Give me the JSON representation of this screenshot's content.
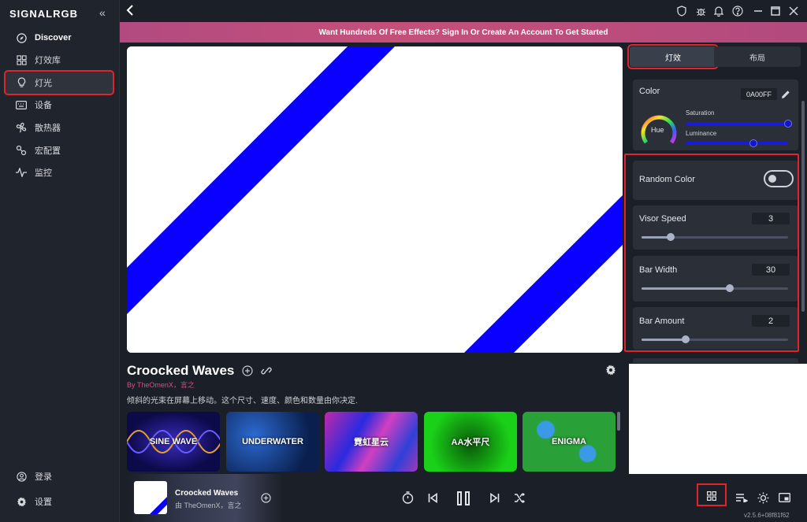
{
  "app": {
    "logo": "SIGNALRGB",
    "version": "v2.5.6+08f81f62"
  },
  "sidebar": {
    "items": [
      {
        "label": "Discover",
        "icon": "compass-icon"
      },
      {
        "label": "灯效库",
        "icon": "grid-icon"
      },
      {
        "label": "灯光",
        "icon": "bulb-icon",
        "active": true
      },
      {
        "label": "设备",
        "icon": "keyboard-icon"
      },
      {
        "label": "散热器",
        "icon": "fan-icon"
      },
      {
        "label": "宏配置",
        "icon": "macro-icon"
      },
      {
        "label": "监控",
        "icon": "pulse-icon"
      }
    ],
    "footer": [
      {
        "label": "登录",
        "icon": "user-icon"
      },
      {
        "label": "设置",
        "icon": "gear-icon"
      }
    ]
  },
  "banner": {
    "text": "Want Hundreds Of Free Effects? Sign In Or Create An Account To Get Started"
  },
  "effect": {
    "title": "Croocked Waves",
    "byline": "By TheOmenX，言之",
    "description": "倾斜的光束在屏幕上移动。这个尺寸、速度、颜色和数量由你决定.",
    "colors": {
      "bar": "#0a00ff",
      "background": "#ffffff"
    }
  },
  "thumbnails": [
    {
      "label": "SINE WAVE"
    },
    {
      "label": "UNDERWATER"
    },
    {
      "label": "霓虹星云"
    },
    {
      "label": "AA水平尺"
    },
    {
      "label": "ENIGMA"
    }
  ],
  "panel": {
    "tabs": [
      {
        "label": "灯效",
        "active": true
      },
      {
        "label": "布局"
      }
    ],
    "color": {
      "label": "Color",
      "hex": "0A00FF",
      "hue_label": "Hue",
      "saturation_label": "Saturation",
      "luminance_label": "Luminance",
      "saturation": 1.0,
      "luminance": 0.66
    },
    "random_color": {
      "label": "Random Color",
      "on": false
    },
    "visor_speed": {
      "label": "Visor Speed",
      "value": "3",
      "fraction": 0.2
    },
    "bar_width": {
      "label": "Bar Width",
      "value": "30",
      "fraction": 0.6
    },
    "bar_amount": {
      "label": "Bar Amount",
      "value": "2",
      "fraction": 0.3
    }
  },
  "player": {
    "title": "Croocked Waves",
    "byline": "由 TheOmenX，言之"
  }
}
